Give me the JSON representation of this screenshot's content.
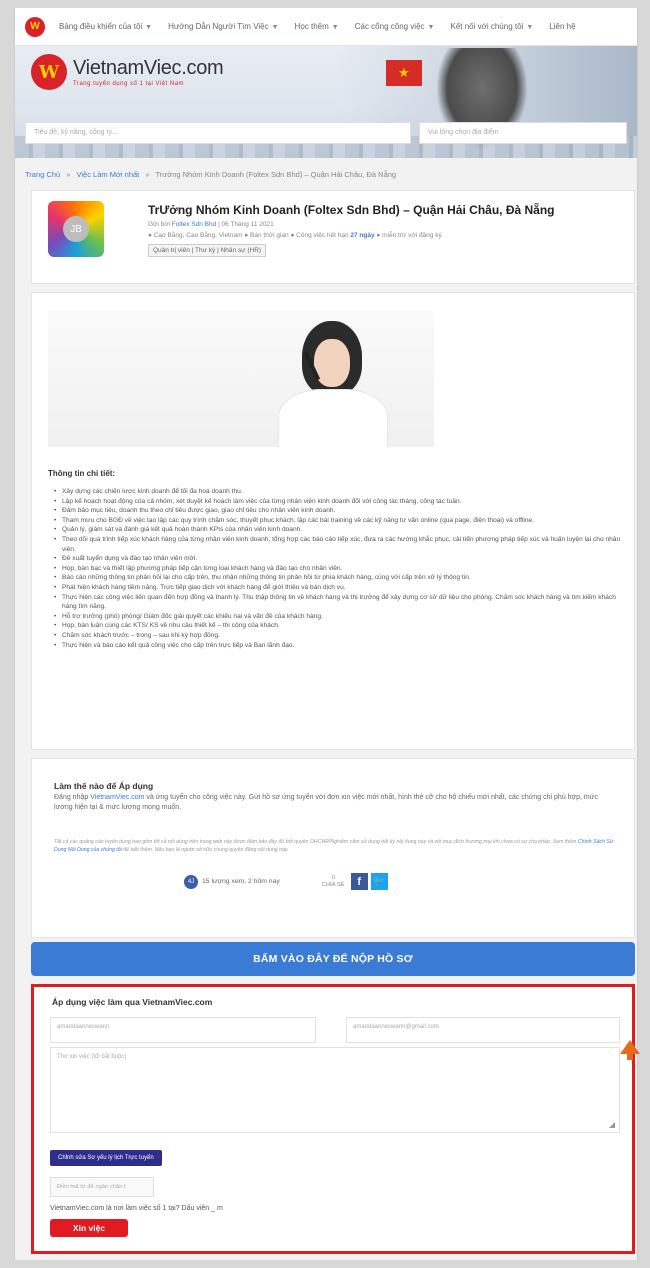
{
  "nav": {
    "items": [
      {
        "label": "Bảng điều khiển của tôi",
        "dropdown": true
      },
      {
        "label": "Hướng Dẫn Người Tìm Việc",
        "dropdown": true
      },
      {
        "label": "Học thêm",
        "dropdown": true
      },
      {
        "label": "Các cổng công việc",
        "dropdown": true
      },
      {
        "label": "Kết nối với chúng tôi",
        "dropdown": true
      },
      {
        "label": "Liên hệ",
        "dropdown": false
      }
    ]
  },
  "brand": {
    "name": "VietnamViec.com",
    "tagline": "Trang tuyển dụng số 1 tại Việt Nam",
    "logo_letter": "W"
  },
  "search": {
    "placeholder": "Tiêu đề, kỹ năng, công ty...",
    "location_placeholder": "Vui lòng chọn địa điểm"
  },
  "breadcrumb": {
    "home": "Trang Chủ",
    "latest": "Việc Làm Mới nhất",
    "current": "Trưởng Nhóm Kinh Doanh (Foltex Sdn Bhd) – Quận Hải Châu, Đà Nẵng",
    "separator": "»"
  },
  "job": {
    "title": "TrƯởng Nhóm Kinh Doanh (Foltex Sdn Bhd) – Quận Hải Châu, Đà Nẵng",
    "logo_initials": "JB",
    "posted_prefix": "Gửi bởi",
    "company": "Foltex Sdn Bhd",
    "posted_suffix": "| 06 Tháng 11 2021",
    "meta": "● Cao Bằng, Cao Bằng, Vietnam  ● Bán thời gian  ● Công việc hết hạn",
    "expires": "27 ngày",
    "meta_tail": "● miễn trừ với đăng ký",
    "category": "Quản trị viên | Thư ký | Nhân sự (HR)"
  },
  "details": {
    "heading": "Thông tin chi tiết:",
    "items": [
      "Xây dựng các chiến lược kinh doanh để tối đa hoá doanh thu.",
      "Lập kế hoạch hoạt động của cả nhóm, xét duyệt kế hoạch làm việc của từng nhân viên kinh doanh đối với công tác tháng, công tác tuần.",
      "Đảm bảo mục tiêu, doanh thu theo chỉ tiêu được giao, giao chỉ tiêu cho nhân viên kinh doanh.",
      "Tham mưu cho BGĐ về việc tạo lập các quy trình chăm sóc, thuyết phục khách, lập các bài training về các kỹ năng tư vấn online (qua page, điện thoại) và offline.",
      "Quản lý, giám sát và đánh giá kết quả hoàn thành KPIs của nhân viên kinh doanh.",
      "Theo dõi quá trình tiếp xúc khách hàng của từng nhân viên kinh doanh, tổng hợp các báo cáo tiếp xúc, đưa ra các hướng khắc phục, cải tiến phương pháp tiếp xúc và huấn luyện lại cho nhân viên.",
      "Đề xuất tuyển dụng và đào tạo nhân viên mới.",
      "Họp, bàn bạc và thiết lập phương pháp tiếp cận từng loại khách hàng và đào tạo cho nhân viên.",
      "Báo cáo những thông tin phản hồi lại cho cấp trên, thu nhận những thông tin phản hồi từ phía khách hàng, cùng với cấp trên xử lý thông tin.",
      "Phát hiện khách hàng tiềm năng. Trực tiếp giao dịch với khách hàng để giới thiệu và bán dịch vụ.",
      "Thực hiện các công việc liên quan đến hợp đồng và thanh lý. Thu thập thông tin về khách hàng và thị trường để xây dựng cơ sở dữ liệu cho phòng. Chăm sóc khách hàng và tìm kiếm khách hàng tìm năng.",
      "Hỗ trợ trưởng (phó) phòng/ Giám đốc giải quyết các khiếu nại và vấn đề của khách hàng.",
      "Họp, bàn luận cùng các KTS/ KS về nhu cầu thiết kế – thi công của khách.",
      "Chăm sóc khách trước – trong – sau khi ký hợp đồng.",
      "Thực hiện và báo cáo kết quả công việc cho cấp trên trực tiếp và Ban lãnh đạo."
    ]
  },
  "how_to_apply": {
    "heading": "Làm thế nào để Áp dụng",
    "text_before": "Đăng nhập",
    "site_link": "VietnamViec.com",
    "text_after": "và ứng tuyển cho công việc này. Gửi hồ sơ ứng tuyển với đơn xin việc mới nhất, hình thẻ cỡ cho hộ chiếu mới nhất, các chứng chỉ phù hợp, mức lương hiện tại & mức lương mong muốn.",
    "note": "Tất cả các quảng cáo tuyển dụng bao gồm tốt cả nội dung trên trang web này được đảm bảo đầy đủ bởi quyền OHCHR/Nghiêm cấm sử dụng bất kỳ nội dung này và với mục đích thương mại khi chưa có sự cho phép. Xem thêm",
    "note_link": "Chính Sách Sử Dụng Nội Dung của chúng tôi",
    "note_tail": "để biết thêm. Nếu bạn là người sở hữu chung quyền đăng nội dung này.",
    "views_badge": "4J",
    "views": "15 lượng xem, 2 hôm nay",
    "share_count": "0",
    "share_label": "CHIA SẺ"
  },
  "cta": {
    "label": "BẤM VÀO ĐÂY ĐỂ NỘP HỒ SƠ"
  },
  "apply_form": {
    "heading": "Áp dụng việc làm qua VietnamViec.com",
    "name_value": "amandaanneswann",
    "email_value": "amandaanneswann@gmail.com",
    "message_placeholder": "Thư xin việc (tối bắt buộc)",
    "edit_cv_label": "Chỉnh sửa Sơ yếu lý lịch Trực tuyến",
    "captcha_placeholder": "Điền mã từ để ngăn chặn t",
    "question": "VietnamViec.com là nơi làm việc số 1 tại? Dấu viên _ m",
    "submit_label": "Xin việc"
  },
  "colors": {
    "brand_red": "#e11b22",
    "link_blue": "#3a7bd5",
    "button_navy": "#2d2d8c",
    "annotation_orange": "#e8691c"
  }
}
